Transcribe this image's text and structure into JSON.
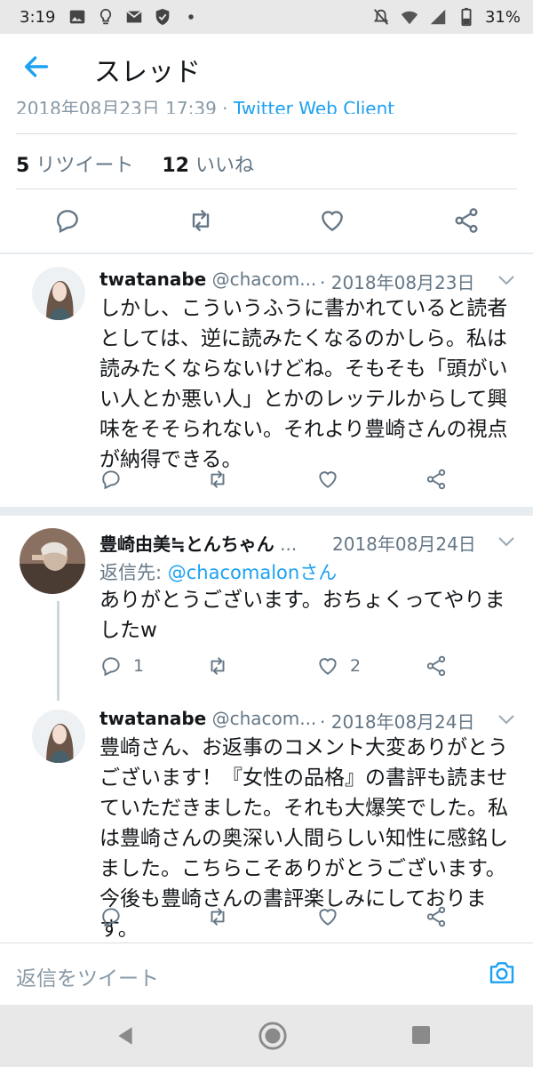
{
  "status_bar": {
    "time": "3:19",
    "battery": "31%",
    "icons_left": [
      "image-icon",
      "bulb-icon",
      "mail-icon",
      "shield-icon",
      "dot-icon"
    ],
    "icons_right": [
      "mute-icon",
      "wifi-icon",
      "signal-icon",
      "battery-icon"
    ]
  },
  "header": {
    "title": "スレッド",
    "back_icon": "arrow-left-icon"
  },
  "main_tweet": {
    "clipped_meta": "2018年08月23日 17:39 · ",
    "clipped_via": "Twitter Web Client",
    "retweet_count": "5",
    "retweet_label": "リツイート",
    "like_count": "12",
    "like_label": "いいね"
  },
  "tweets": [
    {
      "name": "twatanabe",
      "handle": "@chacom...",
      "date": "· 2018年08月23日",
      "text": "しかし、こういうふうに書かれていると読者としては、逆に読みたくなるのかしら。私は読みたくならないけどね。そもそも「頭がいい人とか悪い人」とかのレッテルからして興味をそそられない。それより豊崎さんの視点が納得できる。",
      "reply_count": "",
      "like_count": ""
    },
    {
      "name": "豊崎由美≒とんちゃん",
      "handle": "...",
      "date": "2018年08月24日",
      "reply_prefix": "返信先:",
      "reply_target": "@chacomalonさん",
      "text": "ありがとうございます。おちょくってやりましたw",
      "reply_count": "1",
      "like_count": "2"
    },
    {
      "name": "twatanabe",
      "handle": "@chacom...",
      "date": "· 2018年08月24日",
      "text": "豊崎さん、お返事のコメント大変ありがとうございます！『女性の品格』の書評も読ませていただきました。それも大爆笑でした。私は豊崎さんの奥深い人間らしい知性に感銘しました。こちらこそありがとうございます。今後も豊崎さんの書評楽しみにしております。",
      "reply_count": "",
      "like_count": ""
    }
  ],
  "reply_bar": {
    "placeholder": "返信をツイート",
    "camera_icon": "camera-icon"
  },
  "colors": {
    "accent": "#1da1f2",
    "muted": "#657786",
    "divider": "#e6ecf0"
  }
}
